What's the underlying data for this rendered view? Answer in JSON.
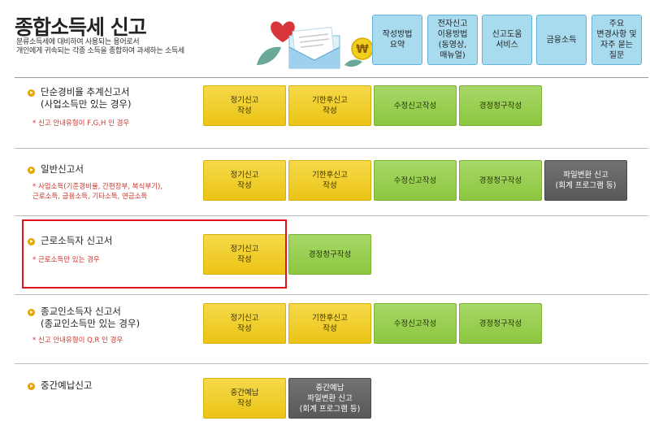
{
  "header": {
    "title": "종합소득세 신고",
    "subtitle_line1": "분류소득세에 대비하여 사용되는 용어로서",
    "subtitle_line2": "개인에게 귀속되는 각종 소득을 종합하여 과세하는 소득세"
  },
  "top_nav": [
    {
      "label": "작성방법\n요약"
    },
    {
      "label": "전자신고\n이용방법\n(동영상,\n매뉴얼)"
    },
    {
      "label": "신고도움\n서비스"
    },
    {
      "label": "금융소득"
    },
    {
      "label": "주요\n변경사항 및\n자주 묻는\n질문"
    }
  ],
  "rows": [
    {
      "title": "단순경비율 추계신고서\n(사업소득만 있는 경우)",
      "note": "* 신고 안내유형이 F,G,H 인 경우",
      "buttons": [
        "정기신고\n작성",
        "기한후신고\n작성",
        "수정신고작성",
        "경정청구작성"
      ]
    },
    {
      "title": "일반신고서",
      "note": "* 사업소득(기준경비율, 간편장부, 복식부기),\n근로소득, 금융소득, 기타소득, 연금소득",
      "buttons": [
        "정기신고\n작성",
        "기한후신고\n작성",
        "수정신고작성",
        "경정청구작성",
        "파일변환 신고\n(회계 프로그램 등)"
      ]
    },
    {
      "title": "근로소득자 신고서",
      "note": "* 근로소득만 있는 경우",
      "buttons": [
        "정기신고\n작성",
        "경정청구작성"
      ]
    },
    {
      "title": "종교인소득자 신고서\n(종교인소득만 있는 경우)",
      "note": "* 신고 안내유형이 Q,R 인 경우",
      "buttons": [
        "정기신고\n작성",
        "기한후신고\n작성",
        "수정신고작성",
        "경정청구작성"
      ]
    },
    {
      "title": "중간예납신고",
      "note": "",
      "buttons": [
        "중간예납\n작성",
        "중간예납\n파일변환 신고\n(회계 프로그램 등)"
      ]
    }
  ],
  "colors": {
    "top_nav_bg": "#a9dbef",
    "yellow_button": "#ebc415",
    "green_button": "#8cc63f",
    "gray_button": "#585858",
    "note_text": "#d0342c",
    "highlight_border": "#e0121c",
    "bullet": "#e5a300"
  },
  "icons": {
    "illustration": [
      "heart-icon",
      "document-icon",
      "won-coin-icon",
      "leaf-icon"
    ]
  }
}
